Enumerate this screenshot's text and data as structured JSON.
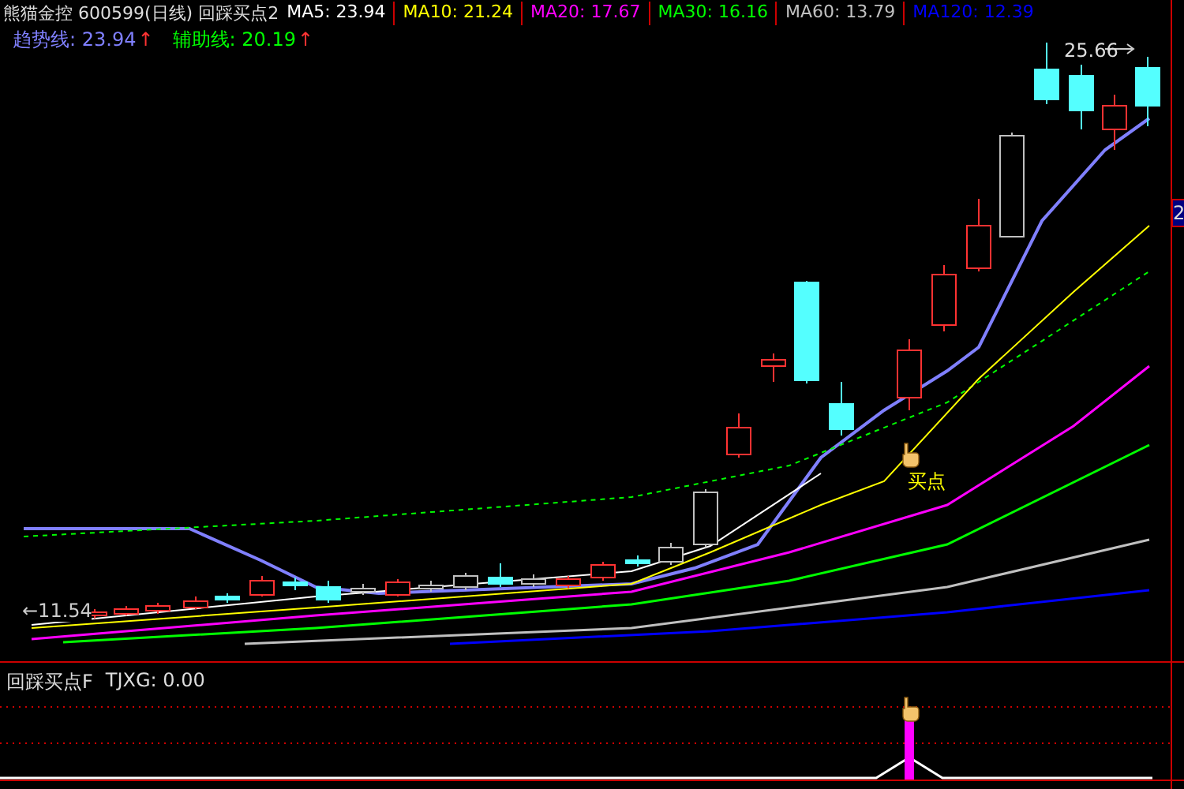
{
  "header": {
    "title": "熊猫金控 600599(日线) 回踩买点2",
    "ma": [
      {
        "label": "MA5: 23.94",
        "color": "#ffffff"
      },
      {
        "label": "MA10: 21.24",
        "color": "#ffff00"
      },
      {
        "label": "MA20: 17.67",
        "color": "#ff00ff"
      },
      {
        "label": "MA30: 16.16",
        "color": "#00ff00"
      },
      {
        "label": "MA60: 13.79",
        "color": "#c0c0c0"
      },
      {
        "label": "MA120: 12.39",
        "color": "#0000ff"
      }
    ]
  },
  "indicators": [
    {
      "label": "趋势线: 23.94",
      "arrow": "↑",
      "color": "#8080ff"
    },
    {
      "label": "辅助线: 20.19",
      "arrow": "↑",
      "color": "#00ff00"
    }
  ],
  "annotations": {
    "high_price": "25.66",
    "low_price": "11.54",
    "low_arrow": "←",
    "buy_signal": "买点"
  },
  "right_axis": {
    "label": "2"
  },
  "sub_panel": {
    "title": "回踩买点F",
    "reading": "TJXG: 0.00"
  }
}
